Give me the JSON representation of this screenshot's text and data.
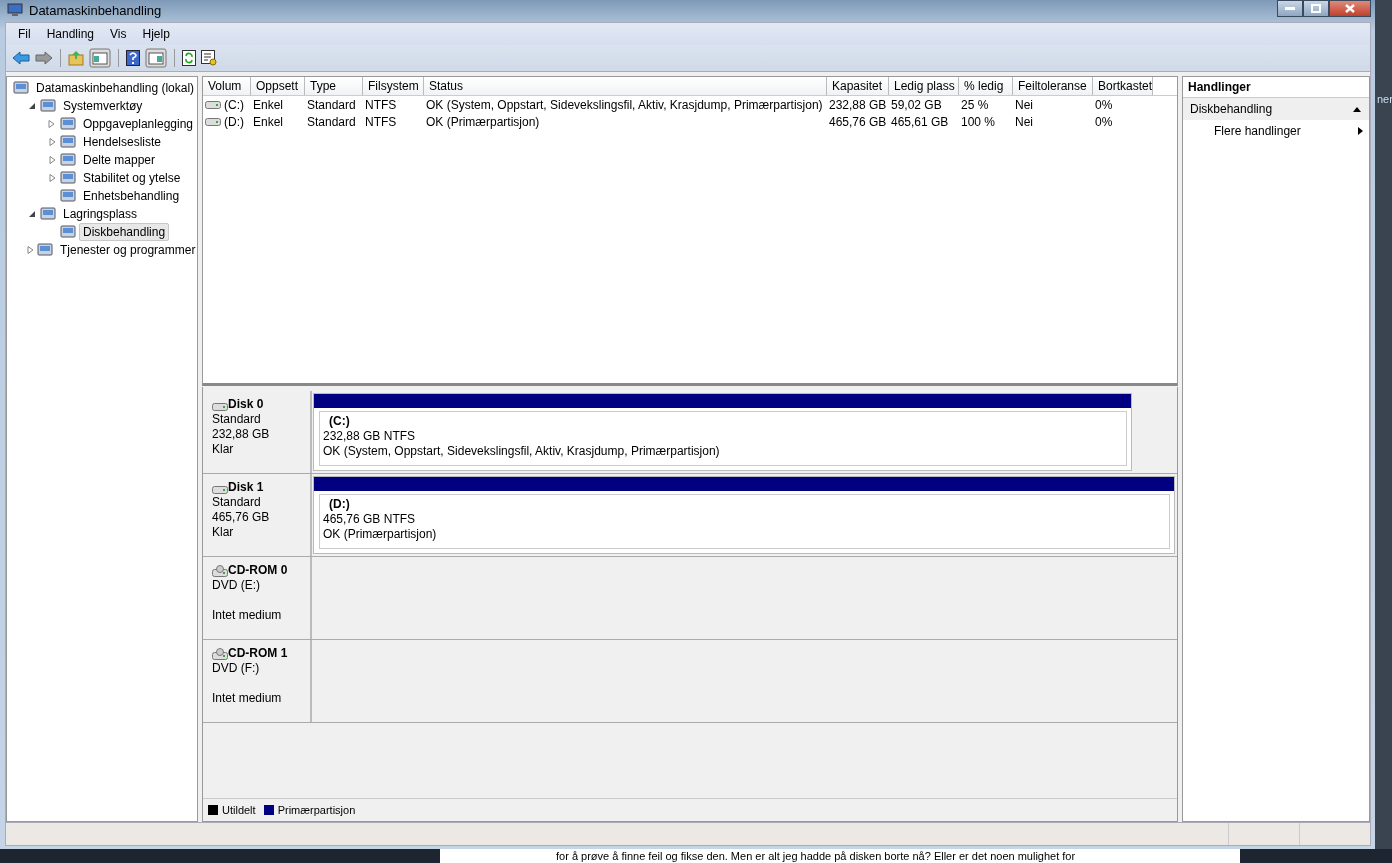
{
  "window": {
    "title": "Datamaskinbehandling"
  },
  "menu": [
    "Fil",
    "Handling",
    "Vis",
    "Hjelp"
  ],
  "tree": [
    {
      "label": "Datamaskinbehandling (lokal)",
      "kind": "root",
      "selected": false,
      "children": [
        {
          "label": "Systemverktøy",
          "kind": "branch",
          "expanded": true,
          "selected": false,
          "children": [
            {
              "label": "Oppgaveplanlegging",
              "kind": "branch",
              "expanded": false,
              "selected": false
            },
            {
              "label": "Hendelsesliste",
              "kind": "branch",
              "expanded": false,
              "selected": false
            },
            {
              "label": "Delte mapper",
              "kind": "branch",
              "expanded": false,
              "selected": false
            },
            {
              "label": "Stabilitet og ytelse",
              "kind": "branch",
              "expanded": false,
              "selected": false
            },
            {
              "label": "Enhetsbehandling",
              "kind": "leaf",
              "selected": false
            }
          ]
        },
        {
          "label": "Lagringsplass",
          "kind": "branch",
          "expanded": true,
          "selected": false,
          "children": [
            {
              "label": "Diskbehandling",
              "kind": "leaf",
              "selected": true
            }
          ]
        },
        {
          "label": "Tjenester og programmer",
          "kind": "branch",
          "expanded": false,
          "selected": false
        }
      ]
    }
  ],
  "volumes": {
    "columns": [
      "Volum",
      "Oppsett",
      "Type",
      "Filsystem",
      "Status",
      "Kapasitet",
      "Ledig plass",
      "% ledig",
      "Feiltoleranse",
      "Bortkastet"
    ],
    "rows": [
      [
        "(C:)",
        "Enkel",
        "Standard",
        "NTFS",
        "OK (System, Oppstart, Sidevekslingsfil, Aktiv, Krasjdump, Primærpartisjon)",
        "232,88 GB",
        "59,02 GB",
        "25 %",
        "Nei",
        "0%"
      ],
      [
        "(D:)",
        "Enkel",
        "Standard",
        "NTFS",
        "OK (Primærpartisjon)",
        "465,76 GB",
        "465,61 GB",
        "100 %",
        "Nei",
        "0%"
      ]
    ]
  },
  "disks": [
    {
      "kind": "disk",
      "name": "Disk 0",
      "type": "Standard",
      "size": "232,88 GB",
      "state": "Klar",
      "level": 0.95,
      "partitions": [
        {
          "label": "(C:)",
          "size": "232,88 GB NTFS",
          "status": "OK (System, Oppstart, Sidevekslingsfil, Aktiv, Krasjdump, Primærpartisjon)",
          "color": "#000080"
        }
      ]
    },
    {
      "kind": "disk",
      "name": "Disk 1",
      "type": "Standard",
      "size": "465,76 GB",
      "state": "Klar",
      "level": 1,
      "partitions": [
        {
          "label": "(D:)",
          "size": "465,76 GB NTFS",
          "status": "OK (Primærpartisjon)",
          "color": "#000080"
        }
      ]
    },
    {
      "kind": "cdrom",
      "name": "CD-ROM 0",
      "type": "DVD (E:)",
      "state": "Intet medium"
    },
    {
      "kind": "cdrom",
      "name": "CD-ROM 1",
      "type": "DVD (F:)",
      "state": "Intet medium"
    }
  ],
  "legend": [
    {
      "label": "Utildelt",
      "color": "#000000"
    },
    {
      "label": "Primærpartisjon",
      "color": "#000080"
    }
  ],
  "actions": {
    "title": "Handlinger",
    "sections": [
      {
        "label": "Diskbehandling",
        "expanded": true,
        "items": [
          "Flere handlinger"
        ]
      }
    ]
  },
  "desktop": {
    "side_text": "ner",
    "page_text": "for å prøve å finne feil og fikse den. Men er alt jeg hadde på disken borte nå? Eller er det noen mulighet for"
  }
}
